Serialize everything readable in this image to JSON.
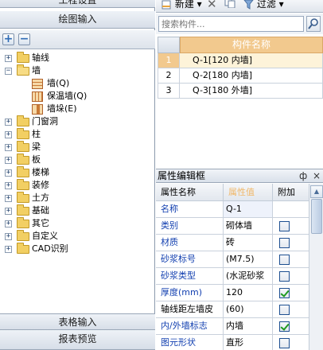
{
  "left_panel": {
    "top_button": "工程设置",
    "section_title": "绘图输入",
    "add_button": "+",
    "remove_button": "−",
    "tree": [
      {
        "label": "轴线",
        "expanded": false
      },
      {
        "label": "墙",
        "expanded": true,
        "children": [
          {
            "label": "墙(Q)"
          },
          {
            "label": "保温墙(Q)"
          },
          {
            "label": "墙垛(E)"
          }
        ]
      },
      {
        "label": "门窗洞",
        "expanded": false
      },
      {
        "label": "柱",
        "expanded": false
      },
      {
        "label": "梁",
        "expanded": false
      },
      {
        "label": "板",
        "expanded": false
      },
      {
        "label": "楼梯",
        "expanded": false
      },
      {
        "label": "装修",
        "expanded": false
      },
      {
        "label": "土方",
        "expanded": false
      },
      {
        "label": "基础",
        "expanded": false
      },
      {
        "label": "其它",
        "expanded": false
      },
      {
        "label": "自定义",
        "expanded": false
      },
      {
        "label": "CAD识别",
        "expanded": false
      }
    ],
    "bottom_buttons": [
      "表格输入",
      "报表预览"
    ]
  },
  "toolbar": {
    "new_label": "新建",
    "filter_label": "过滤"
  },
  "search": {
    "placeholder": "搜索构件..."
  },
  "component_table": {
    "header": "构件名称",
    "rows": [
      {
        "num": "1",
        "name": "Q-1[120 内墙]"
      },
      {
        "num": "2",
        "name": "Q-2[180 内墙]"
      },
      {
        "num": "3",
        "name": "Q-3[180 外墙]"
      }
    ],
    "selected_row": 1
  },
  "property_editor": {
    "title": "属性编辑框",
    "pin": "ф",
    "close": "×",
    "columns": [
      "属性名称",
      "属性值",
      "附加"
    ],
    "rows": [
      {
        "name": "名称",
        "value": "Q-1",
        "checkbox": null,
        "blue": true,
        "editing": true
      },
      {
        "name": "类别",
        "value": "砌体墙",
        "checkbox": false,
        "blue": true
      },
      {
        "name": "材质",
        "value": "砖",
        "checkbox": false,
        "blue": true
      },
      {
        "name": "砂浆标号",
        "value": "(M7.5)",
        "checkbox": false,
        "blue": true
      },
      {
        "name": "砂浆类型",
        "value": "(水泥砂浆",
        "checkbox": false,
        "blue": true
      },
      {
        "name": "厚度(mm)",
        "value": "120",
        "checkbox": true,
        "blue": true
      },
      {
        "name": "轴线距左墙皮",
        "value": "(60)",
        "checkbox": false,
        "blue": false
      },
      {
        "name": "内/外墙标志",
        "value": "内墙",
        "checkbox": true,
        "blue": true
      },
      {
        "name": "图元形状",
        "value": "直形",
        "checkbox": false,
        "blue": true
      }
    ]
  },
  "colors": {
    "header_orange": "#f2c98e",
    "panel_border": "#9aa7b8",
    "blue_text": "#1340b0",
    "check_green": "#1f9a1f"
  }
}
